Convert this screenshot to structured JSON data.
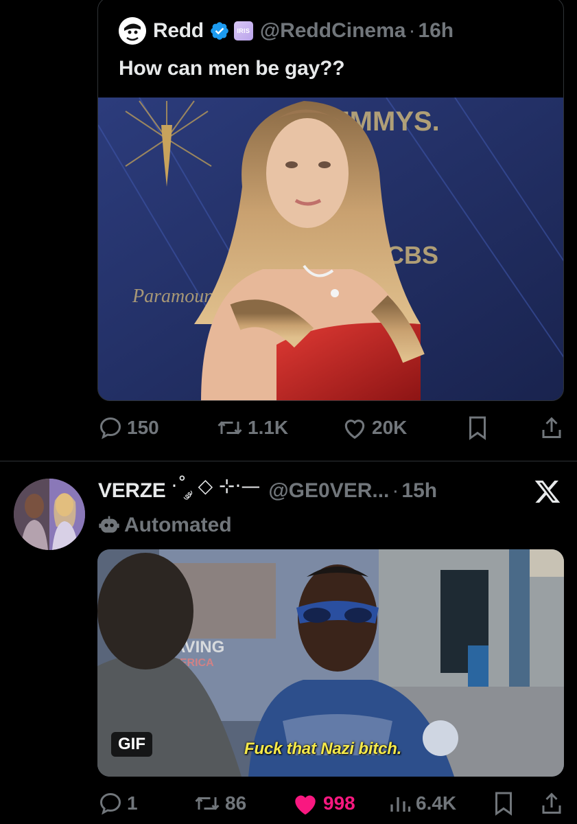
{
  "quote": {
    "name": "Redd",
    "badge_text": "IRIS",
    "handle": "@ReddCinema",
    "separator": "·",
    "time": "16h",
    "text": "How can men be gay??",
    "image_signage": {
      "emmys": "EMMYS.",
      "cbs": "CBS",
      "paramount": "Paramount"
    }
  },
  "tweet1_actions": {
    "replies": "150",
    "reposts": "1.1K",
    "likes": "20K"
  },
  "tweet2": {
    "name": "VERZE",
    "name_decoration": "·˚ ༘ ◇ ⊹·—",
    "handle": "@GE0VER...",
    "separator": "·",
    "time": "15h",
    "automated_label": "Automated",
    "gif_label": "GIF",
    "gif_caption": "Fuck that Nazi bitch.",
    "gif_signage": {
      "saving": "SAVING",
      "america": "AMERICA"
    }
  },
  "tweet2_actions": {
    "replies": "1",
    "reposts": "86",
    "likes": "998",
    "views": "6.4K"
  },
  "colors": {
    "background": "#000000",
    "text": "#e7e9ea",
    "muted": "#71767b",
    "border": "#2f3336",
    "verified_blue": "#1d9bf0",
    "like_pink": "#f91880"
  }
}
